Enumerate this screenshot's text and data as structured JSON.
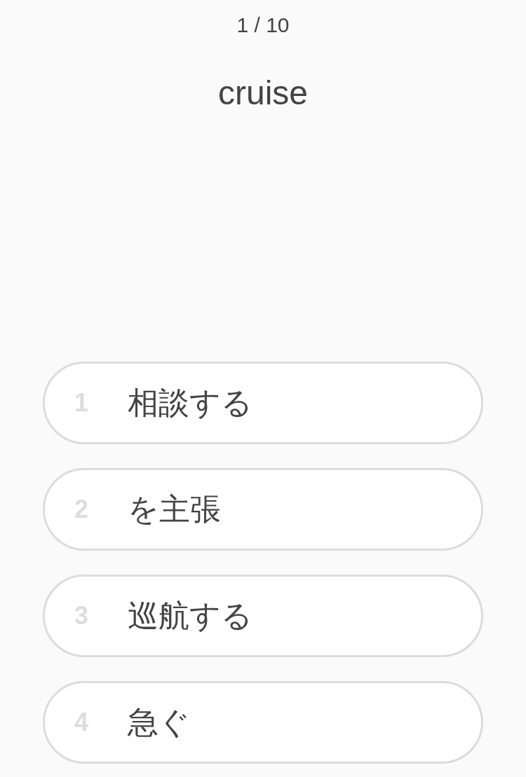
{
  "progress": "1 / 10",
  "word": "cruise",
  "options": [
    {
      "number": "1",
      "label": "相談する"
    },
    {
      "number": "2",
      "label": "を主張"
    },
    {
      "number": "3",
      "label": "巡航する"
    },
    {
      "number": "4",
      "label": "急ぐ"
    }
  ]
}
